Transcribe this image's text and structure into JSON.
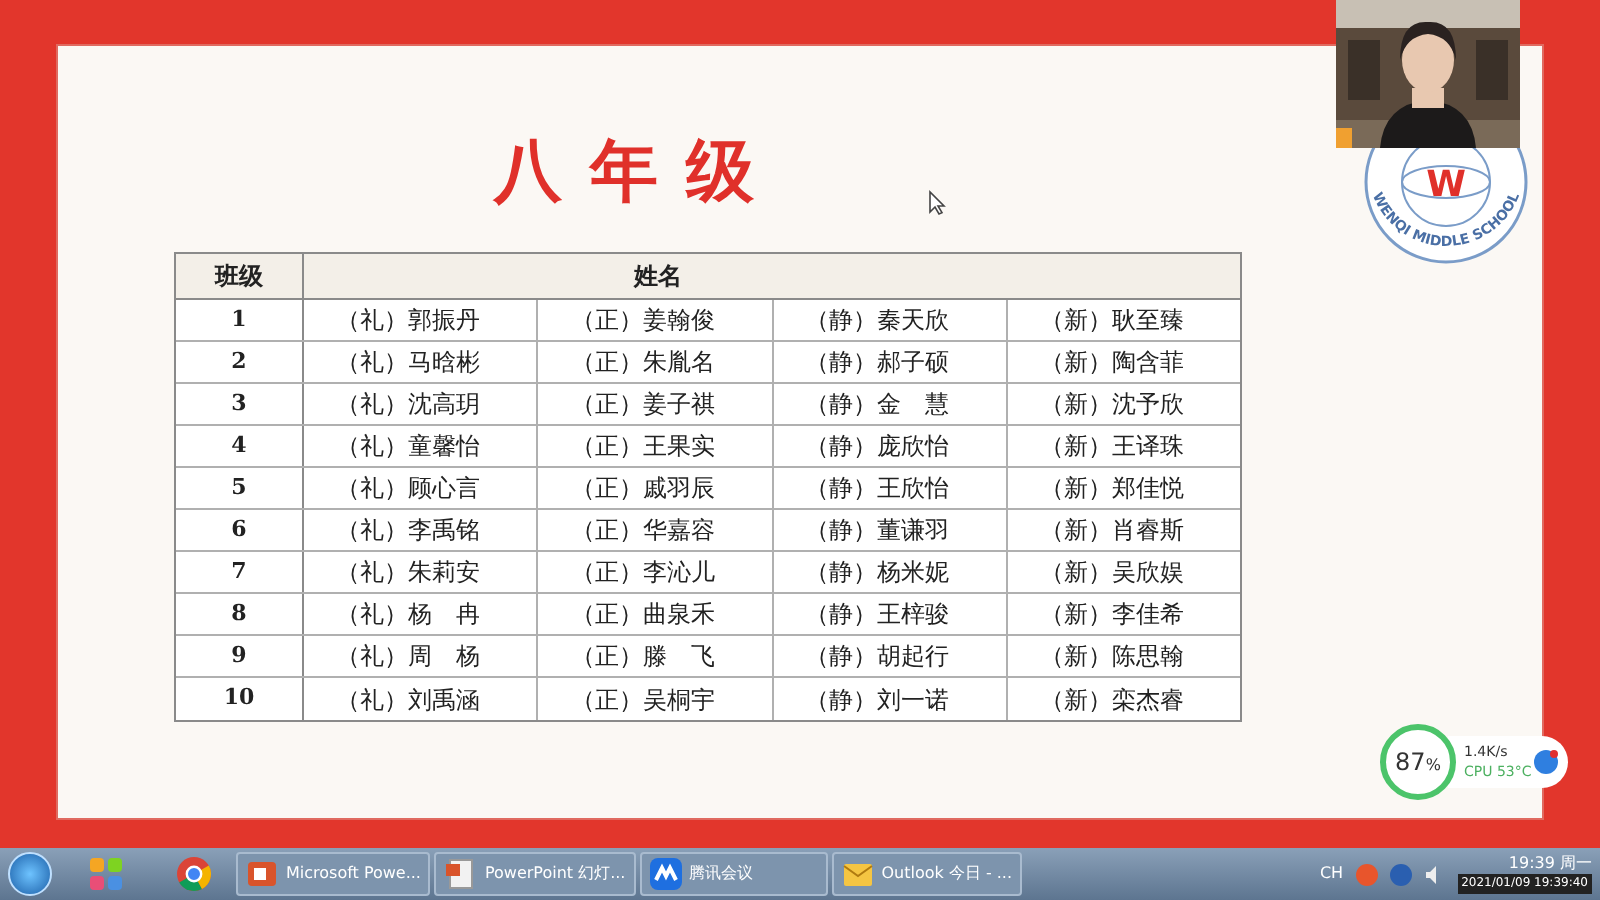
{
  "slide": {
    "title": "八年级",
    "table": {
      "columns": [
        "班级",
        "姓名"
      ],
      "rows": [
        {
          "class": "1",
          "names": [
            "（礼）郭振丹",
            "（正）姜翰俊",
            "（静）秦天欣",
            "（新）耿至臻"
          ]
        },
        {
          "class": "2",
          "names": [
            "（礼）马晗彬",
            "（正）朱胤名",
            "（静）郝子硕",
            "（新）陶含菲"
          ]
        },
        {
          "class": "3",
          "names": [
            "（礼）沈高玥",
            "（正）姜子祺",
            "（静）金　慧",
            "（新）沈予欣"
          ]
        },
        {
          "class": "4",
          "names": [
            "（礼）童馨怡",
            "（正）王果实",
            "（静）庞欣怡",
            "（新）王译珠"
          ]
        },
        {
          "class": "5",
          "names": [
            "（礼）顾心言",
            "（正）戚羽辰",
            "（静）王欣怡",
            "（新）郑佳悦"
          ]
        },
        {
          "class": "6",
          "names": [
            "（礼）李禹铭",
            "（正）华嘉容",
            "（静）董谦羽",
            "（新）肖睿斯"
          ]
        },
        {
          "class": "7",
          "names": [
            "（礼）朱莉安",
            "（正）李沁儿",
            "（静）杨米妮",
            "（新）吴欣娱"
          ]
        },
        {
          "class": "8",
          "names": [
            "（礼）杨　冉",
            "（正）曲泉禾",
            "（静）王梓骏",
            "（新）李佳希"
          ]
        },
        {
          "class": "9",
          "names": [
            "（礼）周　杨",
            "（正）滕　飞",
            "（静）胡起行",
            "（新）陈思翰"
          ]
        },
        {
          "class": "10",
          "names": [
            "（礼）刘禹涵",
            "（正）吴桐宇",
            "（静）刘一诺",
            "（新）栾杰睿"
          ]
        }
      ]
    },
    "logo": {
      "letter": "W",
      "text": "WENQI MIDDLE SCHOOL"
    }
  },
  "monitor": {
    "percent": "87",
    "unit": "%",
    "speed": "1.4K/s",
    "cpu": "CPU 53°C"
  },
  "taskbar": {
    "tasks": [
      {
        "label": "Microsoft Powe...",
        "kind": "ppt"
      },
      {
        "label": "PowerPoint 幻灯...",
        "kind": "slide"
      },
      {
        "label": "腾讯会议",
        "kind": "meeting"
      },
      {
        "label": "Outlook 今日 - ...",
        "kind": "outlook"
      }
    ],
    "language": "CH",
    "time": "19:39 周一",
    "datetime": "2021/01/09 19:39:40"
  }
}
